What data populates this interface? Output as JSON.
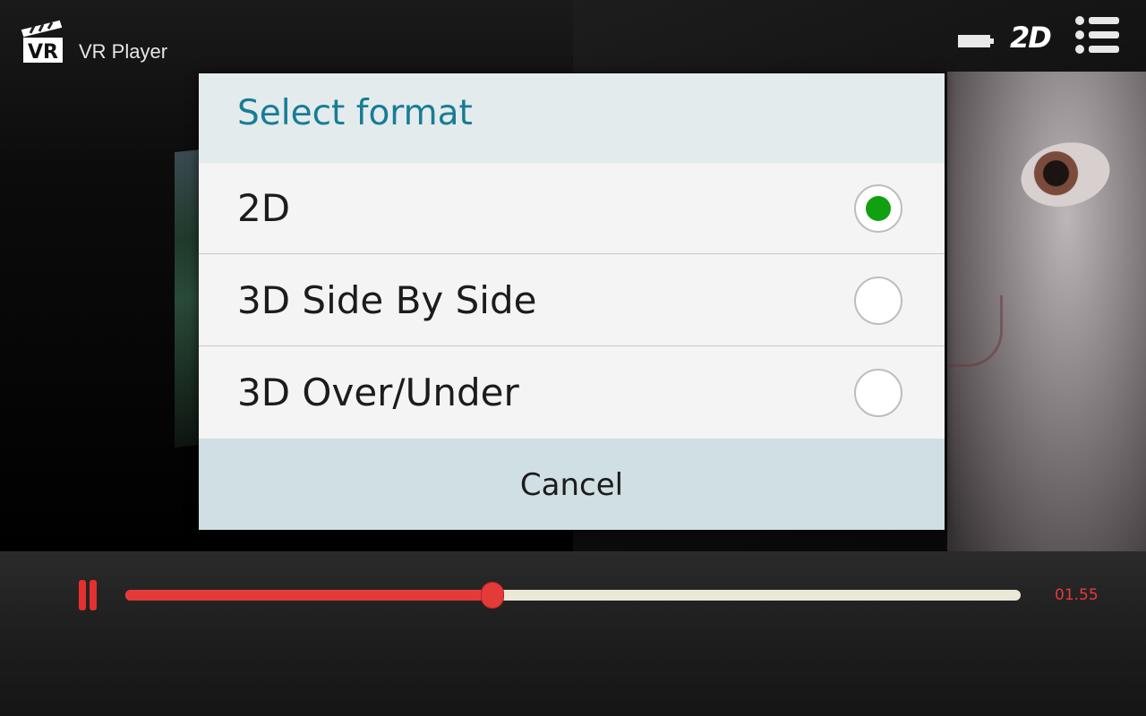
{
  "app": {
    "title": "VR Player",
    "logo_text": "VR"
  },
  "toolbar": {
    "battery_icon": "battery-icon",
    "mode_label": "2D",
    "menu_icon": "list-menu-icon"
  },
  "dialog": {
    "title": "Select format",
    "options": [
      {
        "label": "2D",
        "selected": true
      },
      {
        "label": "3D Side By Side",
        "selected": false
      },
      {
        "label": "3D Over/Under",
        "selected": false
      }
    ],
    "cancel_label": "Cancel"
  },
  "player": {
    "state": "playing",
    "progress": 0.41,
    "time_label": "01.55"
  },
  "colors": {
    "accent_red": "#e53a3a",
    "title_teal": "#177d95",
    "radio_selected_green": "#10a010",
    "header_bg": "#e4ebed",
    "cancel_bg": "#cfdfe3"
  }
}
